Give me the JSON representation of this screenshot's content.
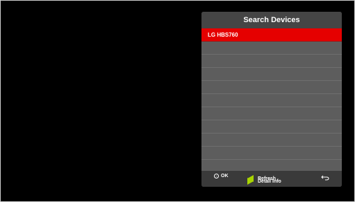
{
  "dialog": {
    "title": "Search Devices",
    "devices": [
      "LG HBS760",
      "",
      "",
      "",
      "",
      "",
      "",
      "",
      "",
      "",
      ""
    ],
    "selected_index": 0
  },
  "footer": {
    "ok_label": "OK",
    "refresh_label": "Refresh",
    "detail_label": "Detail Info",
    "back_icon": "back-arrow-icon"
  },
  "colors": {
    "selection": "#e50000",
    "hint_arrow": "#a8d400",
    "panel": "#5d5d5d",
    "header": "#454545"
  }
}
